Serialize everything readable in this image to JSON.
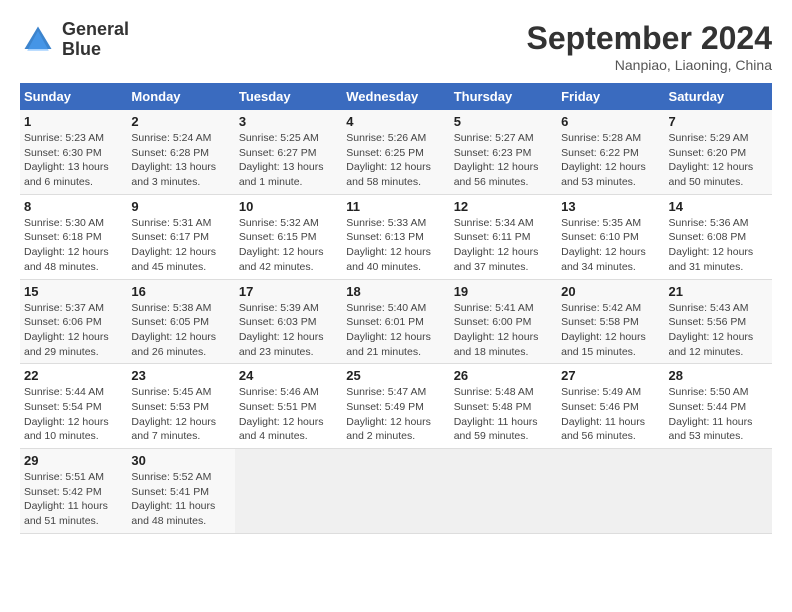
{
  "header": {
    "logo_line1": "General",
    "logo_line2": "Blue",
    "month_year": "September 2024",
    "location": "Nanpiao, Liaoning, China"
  },
  "weekdays": [
    "Sunday",
    "Monday",
    "Tuesday",
    "Wednesday",
    "Thursday",
    "Friday",
    "Saturday"
  ],
  "weeks": [
    [
      {
        "day": "1",
        "info": "Sunrise: 5:23 AM\nSunset: 6:30 PM\nDaylight: 13 hours\nand 6 minutes."
      },
      {
        "day": "2",
        "info": "Sunrise: 5:24 AM\nSunset: 6:28 PM\nDaylight: 13 hours\nand 3 minutes."
      },
      {
        "day": "3",
        "info": "Sunrise: 5:25 AM\nSunset: 6:27 PM\nDaylight: 13 hours\nand 1 minute."
      },
      {
        "day": "4",
        "info": "Sunrise: 5:26 AM\nSunset: 6:25 PM\nDaylight: 12 hours\nand 58 minutes."
      },
      {
        "day": "5",
        "info": "Sunrise: 5:27 AM\nSunset: 6:23 PM\nDaylight: 12 hours\nand 56 minutes."
      },
      {
        "day": "6",
        "info": "Sunrise: 5:28 AM\nSunset: 6:22 PM\nDaylight: 12 hours\nand 53 minutes."
      },
      {
        "day": "7",
        "info": "Sunrise: 5:29 AM\nSunset: 6:20 PM\nDaylight: 12 hours\nand 50 minutes."
      }
    ],
    [
      {
        "day": "8",
        "info": "Sunrise: 5:30 AM\nSunset: 6:18 PM\nDaylight: 12 hours\nand 48 minutes."
      },
      {
        "day": "9",
        "info": "Sunrise: 5:31 AM\nSunset: 6:17 PM\nDaylight: 12 hours\nand 45 minutes."
      },
      {
        "day": "10",
        "info": "Sunrise: 5:32 AM\nSunset: 6:15 PM\nDaylight: 12 hours\nand 42 minutes."
      },
      {
        "day": "11",
        "info": "Sunrise: 5:33 AM\nSunset: 6:13 PM\nDaylight: 12 hours\nand 40 minutes."
      },
      {
        "day": "12",
        "info": "Sunrise: 5:34 AM\nSunset: 6:11 PM\nDaylight: 12 hours\nand 37 minutes."
      },
      {
        "day": "13",
        "info": "Sunrise: 5:35 AM\nSunset: 6:10 PM\nDaylight: 12 hours\nand 34 minutes."
      },
      {
        "day": "14",
        "info": "Sunrise: 5:36 AM\nSunset: 6:08 PM\nDaylight: 12 hours\nand 31 minutes."
      }
    ],
    [
      {
        "day": "15",
        "info": "Sunrise: 5:37 AM\nSunset: 6:06 PM\nDaylight: 12 hours\nand 29 minutes."
      },
      {
        "day": "16",
        "info": "Sunrise: 5:38 AM\nSunset: 6:05 PM\nDaylight: 12 hours\nand 26 minutes."
      },
      {
        "day": "17",
        "info": "Sunrise: 5:39 AM\nSunset: 6:03 PM\nDaylight: 12 hours\nand 23 minutes."
      },
      {
        "day": "18",
        "info": "Sunrise: 5:40 AM\nSunset: 6:01 PM\nDaylight: 12 hours\nand 21 minutes."
      },
      {
        "day": "19",
        "info": "Sunrise: 5:41 AM\nSunset: 6:00 PM\nDaylight: 12 hours\nand 18 minutes."
      },
      {
        "day": "20",
        "info": "Sunrise: 5:42 AM\nSunset: 5:58 PM\nDaylight: 12 hours\nand 15 minutes."
      },
      {
        "day": "21",
        "info": "Sunrise: 5:43 AM\nSunset: 5:56 PM\nDaylight: 12 hours\nand 12 minutes."
      }
    ],
    [
      {
        "day": "22",
        "info": "Sunrise: 5:44 AM\nSunset: 5:54 PM\nDaylight: 12 hours\nand 10 minutes."
      },
      {
        "day": "23",
        "info": "Sunrise: 5:45 AM\nSunset: 5:53 PM\nDaylight: 12 hours\nand 7 minutes."
      },
      {
        "day": "24",
        "info": "Sunrise: 5:46 AM\nSunset: 5:51 PM\nDaylight: 12 hours\nand 4 minutes."
      },
      {
        "day": "25",
        "info": "Sunrise: 5:47 AM\nSunset: 5:49 PM\nDaylight: 12 hours\nand 2 minutes."
      },
      {
        "day": "26",
        "info": "Sunrise: 5:48 AM\nSunset: 5:48 PM\nDaylight: 11 hours\nand 59 minutes."
      },
      {
        "day": "27",
        "info": "Sunrise: 5:49 AM\nSunset: 5:46 PM\nDaylight: 11 hours\nand 56 minutes."
      },
      {
        "day": "28",
        "info": "Sunrise: 5:50 AM\nSunset: 5:44 PM\nDaylight: 11 hours\nand 53 minutes."
      }
    ],
    [
      {
        "day": "29",
        "info": "Sunrise: 5:51 AM\nSunset: 5:42 PM\nDaylight: 11 hours\nand 51 minutes."
      },
      {
        "day": "30",
        "info": "Sunrise: 5:52 AM\nSunset: 5:41 PM\nDaylight: 11 hours\nand 48 minutes."
      },
      {
        "day": "",
        "info": ""
      },
      {
        "day": "",
        "info": ""
      },
      {
        "day": "",
        "info": ""
      },
      {
        "day": "",
        "info": ""
      },
      {
        "day": "",
        "info": ""
      }
    ]
  ]
}
